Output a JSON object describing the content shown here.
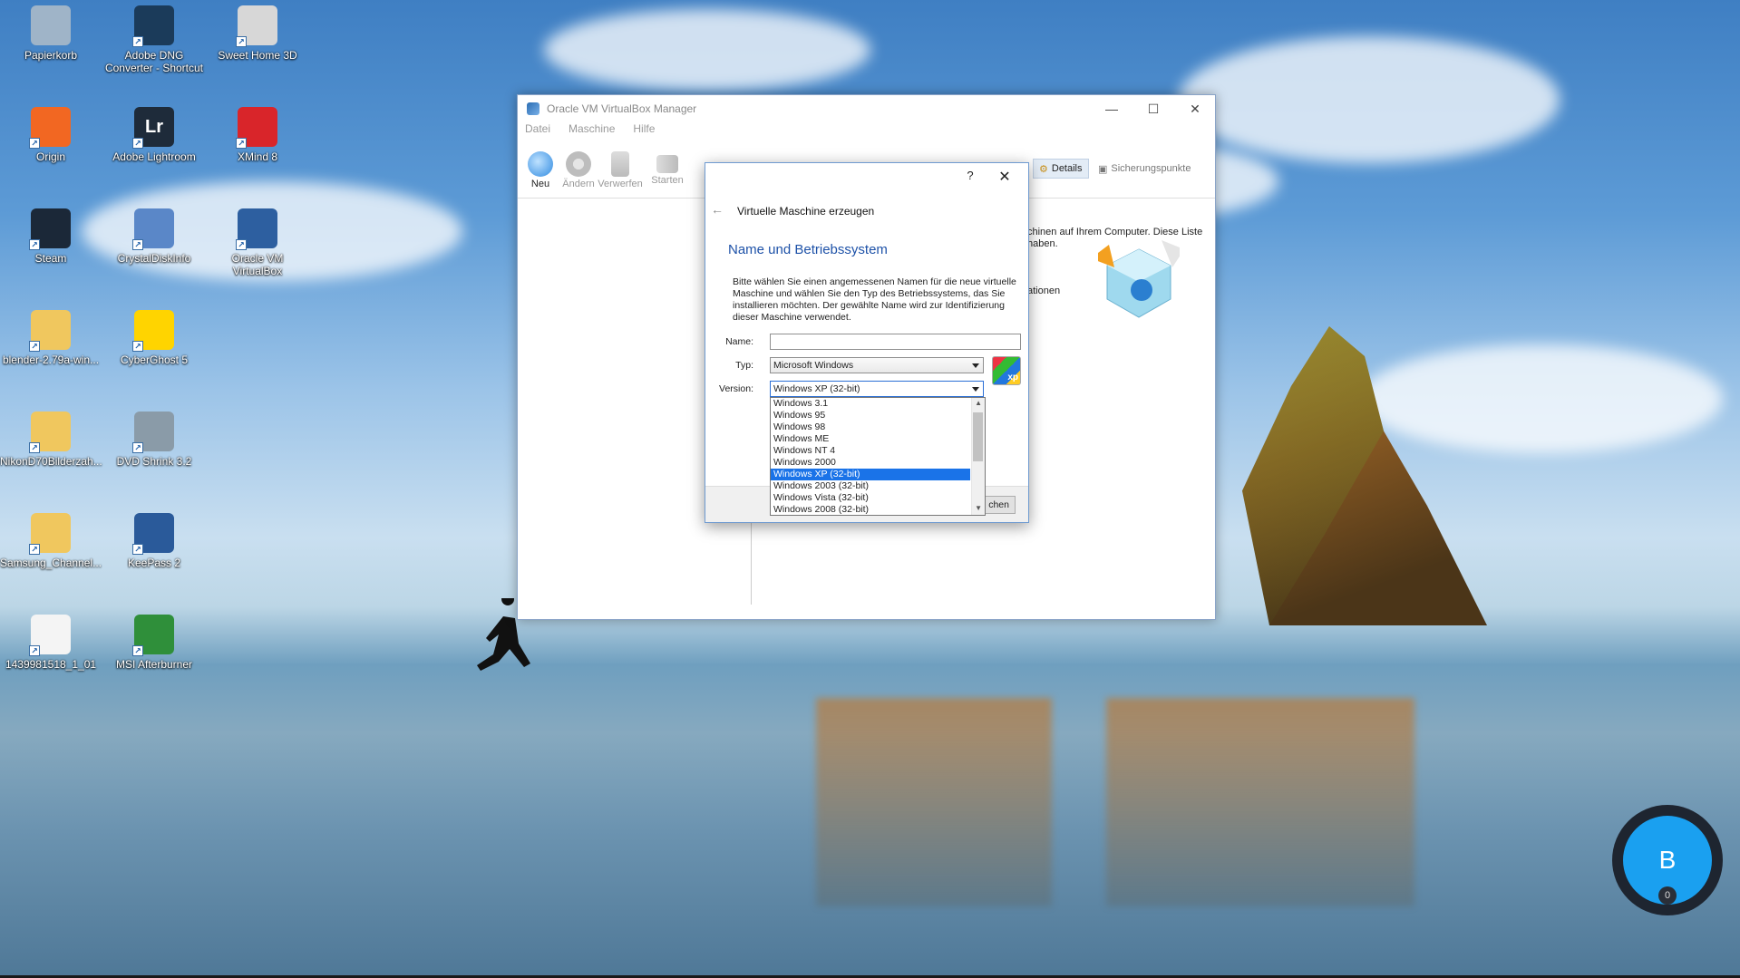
{
  "desktop": {
    "icons": [
      {
        "label": "Papierkorb",
        "icon": "recycle-bin-icon",
        "color": "#9fb4c8"
      },
      {
        "label": "Adobe DNG Converter - Shortcut",
        "icon": "adobe-dng-icon",
        "color": "#1b3b5a"
      },
      {
        "label": "Sweet Home 3D",
        "icon": "sweet-home-icon",
        "color": "#d7d7d7"
      },
      {
        "label": "Origin",
        "icon": "origin-icon",
        "color": "#f26722"
      },
      {
        "label": "Adobe Lightroom",
        "icon": "lightroom-icon",
        "color": "#1e2b3a",
        "glyph": "Lr"
      },
      {
        "label": "XMind 8",
        "icon": "xmind-icon",
        "color": "#d9252a"
      },
      {
        "label": "Steam",
        "icon": "steam-icon",
        "color": "#1b2838"
      },
      {
        "label": "CrystalDiskInfo",
        "icon": "crystaldiskinfo-icon",
        "color": "#5a87c8"
      },
      {
        "label": "Oracle VM VirtualBox",
        "icon": "virtualbox-icon",
        "color": "#2d5fa0"
      },
      {
        "label": "blender-2.79a-win...",
        "icon": "folder-icon",
        "color": "#f0c75e"
      },
      {
        "label": "CyberGhost 5",
        "icon": "cyberghost-icon",
        "color": "#ffd400"
      },
      {
        "label": "NikonD70Bilderzah...",
        "icon": "folder-icon",
        "color": "#f0c75e"
      },
      {
        "label": "DVD Shrink 3.2",
        "icon": "dvd-shrink-icon",
        "color": "#8a9ba8"
      },
      {
        "label": "Samsung_Channel...",
        "icon": "folder-icon",
        "color": "#f0c75e"
      },
      {
        "label": "KeePass 2",
        "icon": "keepass-icon",
        "color": "#2a5a9a"
      },
      {
        "label": "1439981518_1_01",
        "icon": "file-icon",
        "color": "#f4f4f4"
      },
      {
        "label": "MSI Afterburner",
        "icon": "msi-afterburner-icon",
        "color": "#2f8f3a"
      }
    ]
  },
  "vbox": {
    "title": "Oracle VM VirtualBox Manager",
    "menu": [
      "Datei",
      "Maschine",
      "Hilfe"
    ],
    "toolbar": [
      "Neu",
      "Ändern",
      "Verwerfen",
      "Starten"
    ],
    "tabs": {
      "details": "Details",
      "snapshots": "Sicherungspunkte"
    },
    "welcome_lines": [
      "chinen auf Ihrem Computer. Diese Liste",
      "haben.",
      "",
      "",
      "",
      "ationen"
    ]
  },
  "wizard": {
    "title": "Virtuelle Maschine erzeugen",
    "heading": "Name und Betriebssystem",
    "description": "Bitte wählen Sie einen angemessenen Namen für die neue virtuelle Maschine und wählen Sie den Typ des Betriebssystems, das Sie installieren möchten. Der gewählte Name wird zur Identifizierung dieser Maschine verwendet.",
    "name_label": "Name:",
    "name_value": "",
    "type_label": "Typ:",
    "type_value": "Microsoft Windows",
    "version_label": "Version:",
    "version_value": "Windows XP (32-bit)",
    "help": "?",
    "finish_label": "chen",
    "os_badge": "xp"
  },
  "version_options": [
    "Windows 3.1",
    "Windows 95",
    "Windows 98",
    "Windows ME",
    "Windows NT 4",
    "Windows 2000",
    "Windows XP (32-bit)",
    "Windows 2003 (32-bit)",
    "Windows Vista (32-bit)",
    "Windows 2008 (32-bit)"
  ],
  "selected_option": "Windows XP (32-bit)",
  "badge": {
    "letter": "B",
    "count": "0",
    "color": "#1aa0f0"
  }
}
